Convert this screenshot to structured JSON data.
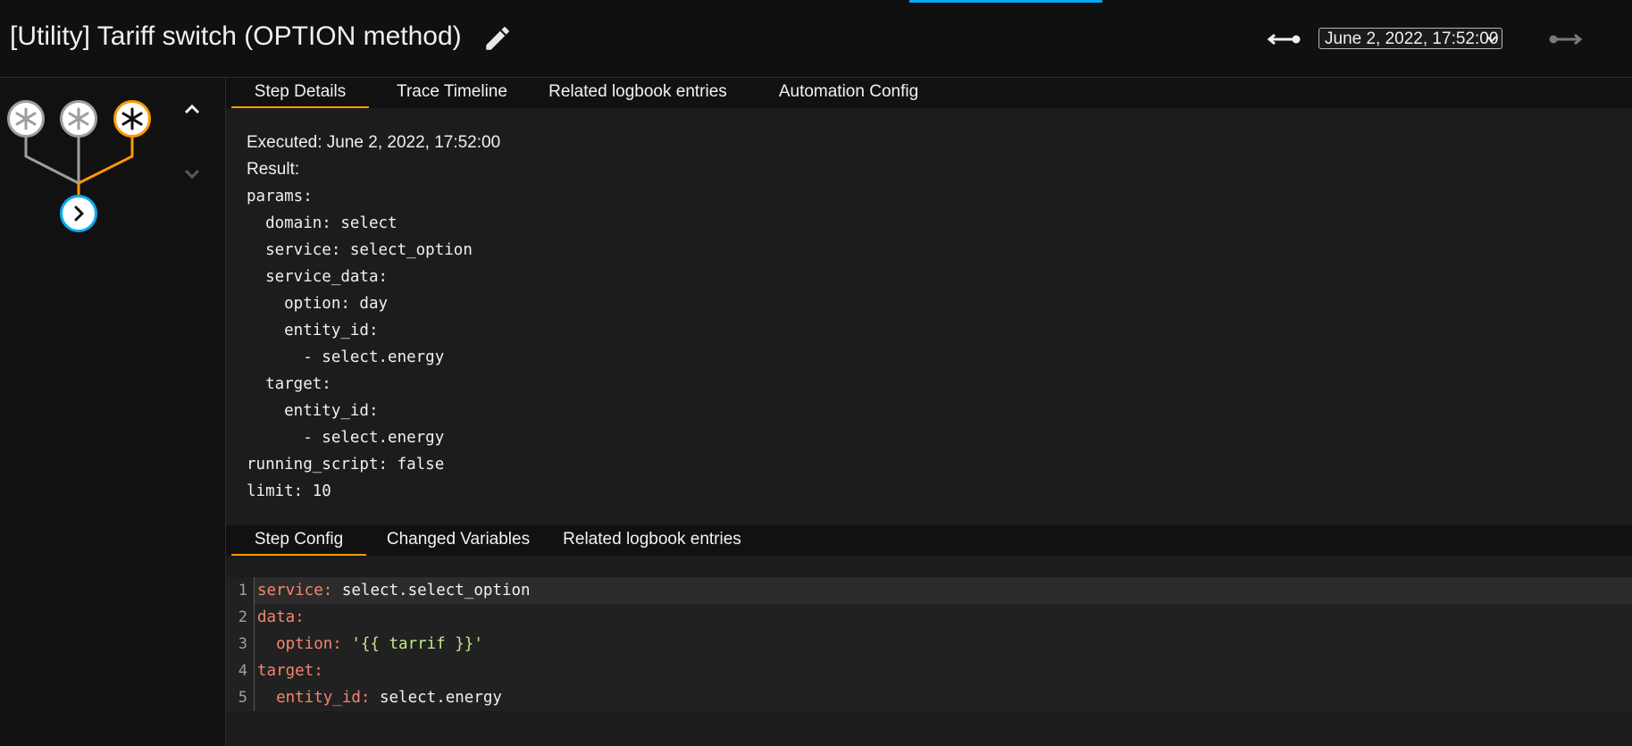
{
  "header": {
    "title": "[Utility] Tariff switch (OPTION method)",
    "selected_run": "June 2, 2022, 17:52:00"
  },
  "graph": {
    "icons": [
      "edit-icon",
      "trigger-icon",
      "action-icon",
      "chevron-up-icon",
      "chevron-down-icon"
    ],
    "colors": {
      "active": "#ff9800",
      "inactive": "#9e9e9e",
      "action": "#03a9f4"
    }
  },
  "upper_tabs": [
    "Step Details",
    "Trace Timeline",
    "Related logbook entries",
    "Automation Config"
  ],
  "step_details": {
    "executed": "Executed: June 2, 2022, 17:52:00",
    "result_label": "Result:",
    "yaml": [
      "params:",
      "  domain: select",
      "  service: select_option",
      "  service_data:",
      "    option: day",
      "    entity_id:",
      "      - select.energy",
      "  target:",
      "    entity_id:",
      "      - select.energy",
      "running_script: false",
      "limit: 10"
    ]
  },
  "lower_tabs": [
    "Step Config",
    "Changed Variables",
    "Related logbook entries"
  ],
  "step_config": {
    "line_numbers": [
      "1",
      "2",
      "3",
      "4",
      "5"
    ],
    "lines": [
      {
        "key": "service:",
        "value": " select.select_option"
      },
      {
        "key": "data:",
        "value": ""
      },
      {
        "key": "  option:",
        "value": " '{{ tarrif }}'"
      },
      {
        "key": "target:",
        "value": ""
      },
      {
        "key": "  entity_id:",
        "value": " select.energy"
      }
    ]
  }
}
